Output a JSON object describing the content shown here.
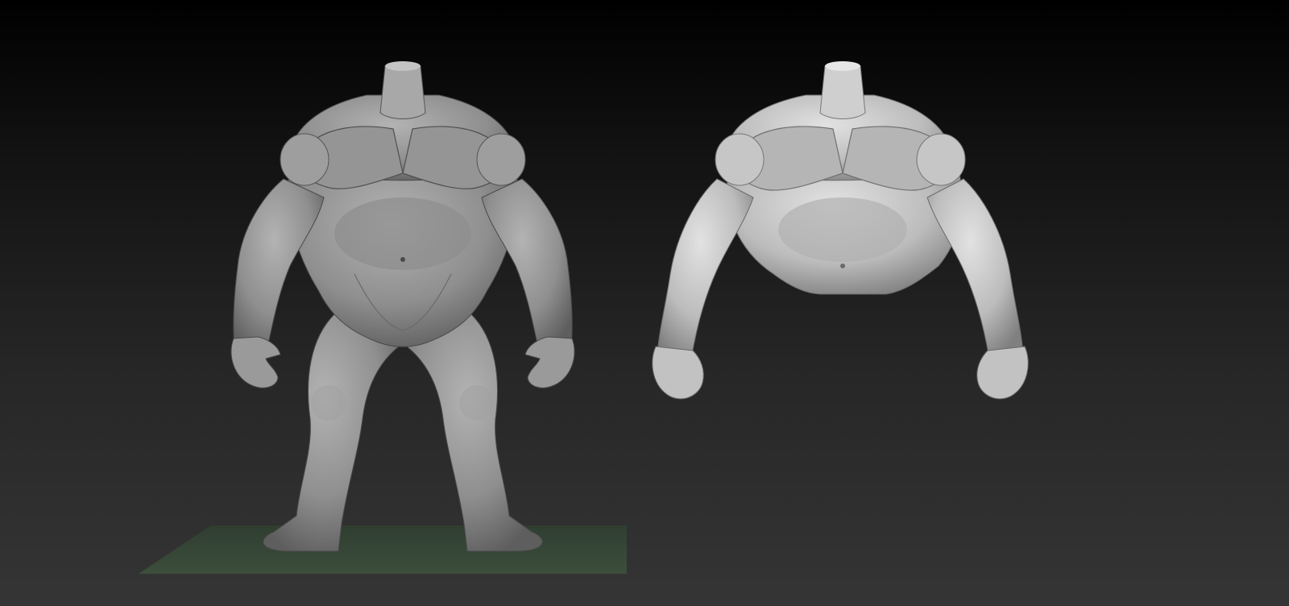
{
  "viewport": {
    "background_top": "#000000",
    "background_bottom": "#353535",
    "ground_color": "#3f5a3f"
  },
  "models": [
    {
      "id": "full-body",
      "icon": "sculpt-full-body-icon",
      "base_color": "#9a9a9a",
      "shade_color": "#5a5a5a",
      "highlight_color": "#b8b8b8"
    },
    {
      "id": "upper-body",
      "icon": "sculpt-upper-body-icon",
      "base_color": "#bdbdbd",
      "shade_color": "#7a7a7a",
      "highlight_color": "#dcdcdc"
    }
  ]
}
